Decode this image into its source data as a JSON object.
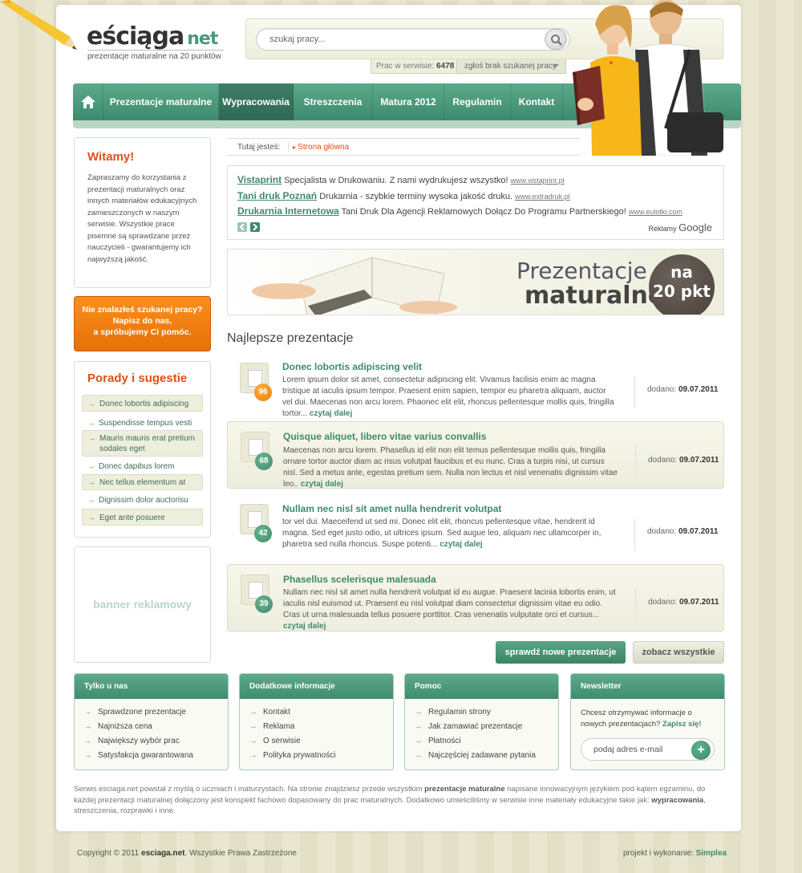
{
  "logo": {
    "main": "eściąga",
    "net": "net",
    "tagline": "prezentacje maturalne na 20 punktów"
  },
  "search": {
    "placeholder": "szukaj pracy...",
    "stats_label": "Prac w serwisie:",
    "stats_count": "6478",
    "report_label": "zgłoś brak szukanej pracy"
  },
  "nav": {
    "items": [
      "Prezentacje maturalne",
      "Wypracowania",
      "Streszczenia",
      "Matura 2012",
      "Regulamin",
      "Kontakt"
    ],
    "active": "Wypracowania"
  },
  "breadcrumb": {
    "label": "Tutaj jesteś:",
    "current": "Strona główna"
  },
  "ads": {
    "items": [
      {
        "title": "Vistaprint",
        "text": "Specjalista w Drukowaniu. Z nami wydrukujesz wszystko!",
        "url": "www.vistaprint.pl"
      },
      {
        "title": "Tani druk Poznań",
        "text": "Drukarnia - szybkie terminy wysoka jakość druku.",
        "url": "www.extradruk.pl"
      },
      {
        "title": "Drukarnia Internetowa",
        "text": "Tani Druk Dla Agencji Reklamowych Dołącz Do Programu Partnerskiego!",
        "url": "www.eulotki.com"
      }
    ],
    "by": "Reklamy",
    "brand": "Google"
  },
  "banner": {
    "line1": "Prezentacje",
    "line2": "maturalne",
    "circle1": "na",
    "circle2": "20 pkt"
  },
  "section_title": "Najlepsze prezentacje",
  "presentations": [
    {
      "score": "96",
      "title": "Donec lobortis adipiscing velit",
      "desc": "Lorem ipsum dolor sit amet, consectetur adipiscing elit. Vivamus facilisis enim ac magna tristique at iaculis ipsum tempor. Praesent enim sapien, tempor eu pharetra aliquam, auctor vel dui. Maecenas non arcu lorem. Phaonec elit elit, rhoncus pellentesque mollis quis, fringilla tortor...",
      "more": "czytaj dalej",
      "date_label": "dodano:",
      "date": "09.07.2011"
    },
    {
      "score": "68",
      "title": "Quisque aliquet, libero vitae varius convallis",
      "desc": "Maecenas non arcu lorem. Phasellus id elit non elit temus pellentesque mollis quis, fringilla ornare tortor auctor diam ac risus volutpat faucibus et eu nunc. Cras a turpis nisi, ut cursus nisl. Sed a metus ante, egestas pretium sem. Nulla non lectus et nisl venenatis dignissim vitae leo..",
      "more": "czytaj dalej",
      "date_label": "dodano:",
      "date": "09.07.2011"
    },
    {
      "score": "42",
      "title": "Nullam nec nisl sit amet nulla hendrerit volutpat",
      "desc": "tor vel dui. Maeceifend ut sed mi. Donec elit elit, rhoncus pellentesque  vitae, hendrerit id magna. Sed eget justo odio, ut ultrices ipsum. Sed augue leo, aliquam nec ullamcorper in, pharetra sed nulla rhoncus. Suspe potenti...",
      "more": "czytaj dalej",
      "date_label": "dodano:",
      "date": "09.07.2011"
    },
    {
      "score": "39",
      "title": "Phasellus scelerisque malesuada",
      "desc": "Nullam nec nisl sit amet nulla hendrerit volutpat id eu augue. Praesent lacinia lobortis enim, ut iaculis nisl euismod ut. Praesent eu nisl volutpat diam consectetur dignissim vitae eu odio. Cras ut urna malesuada tellus posuere porttitor. Cras venenatis vulputate orci et cursus...",
      "more": "czytaj dalej",
      "date_label": "dodano:",
      "date": "09.07.2011"
    }
  ],
  "buttons": {
    "new": "sprawdź nowe prezentacje",
    "all": "zobacz wszystkie"
  },
  "sidebar": {
    "welcome_title": "Witamy!",
    "welcome_text": "Zapraszamy do korzystania z prezentacji maturalnych oraz innych materiałów edukacyjnych zamieszczonych w naszym serwisie. Wszystkie prace pisemne są sprawdzane przez nauczycieli - gwarantujemy ich najwyższą jakość.",
    "cta": [
      "Nie znalazłeś szukanej pracy?",
      "Napisz do nas,",
      "a spróbujemy Ci pomóc."
    ],
    "tips_title": "Porady i sugestie",
    "tips": [
      "Donec lobortis adipiscing",
      "Suspendisse tempus vesti",
      "Mauris mauris erat pretium sodales eget",
      "Donec dapibus lorem",
      "Nec tellus elementum at",
      "Dignissim dolor auctorisu",
      "Eget ante posuere"
    ],
    "ad_banner": "banner reklamowy"
  },
  "footer_boxes": [
    {
      "title": "Tylko u nas",
      "links": [
        "Sprawdzone prezentacje",
        "Najniższa cena",
        "Największy wybór prac",
        "Satysfakcja gwarantowana"
      ]
    },
    {
      "title": "Dodatkowe informacje",
      "links": [
        "Kontakt",
        "Reklama",
        "O serwisie",
        "Polityka prywatności"
      ]
    },
    {
      "title": "Pomoc",
      "links": [
        "Regulamin strony",
        "Jak zamawiać prezentacje",
        "Płatności",
        "Najczęściej zadawane pytania"
      ]
    }
  ],
  "newsletter": {
    "title": "Newsletter",
    "text": "Chcesz otrzymywać informacje o nowych prezentacjach?",
    "cta": "Zapisz się!",
    "placeholder": "podaj adres e-mail",
    "button": "+"
  },
  "about": {
    "p1": "Serwis esciaga.net powstał z myślą o uczniach i maturzystach. Na stronie znajdziesz przede wszystkim",
    "b1": "prezentacje maturalne",
    "p2": "napisane innowacyjnym językiem pod kątem egzaminu, do każdej prezentacji maturalnej dołączony jest konspekt fachowo dopasowany do prac maturalnych. Dodatkowo umieściliśmy w serwisie inne materiały edukacyjne takie jak:",
    "b2": "wypracowania",
    "p3": ", streszczenia, rozprawki i inne."
  },
  "footer": {
    "copy_prefix": "Copyright © 2011",
    "copy_site": "esciaga.net",
    "copy_suffix": ". Wszystkie Prawa Zastrzeżone",
    "credit_label": "projekt i wykonanie:",
    "credit_name": "Simplea"
  },
  "colors": {
    "accent": "#3f8a6d",
    "orange": "#e0501a",
    "cta": "#f58a16"
  },
  "icons": [
    "pencil-icon",
    "search-icon",
    "home-icon",
    "document-icon",
    "arrow-right-icon",
    "plus-icon"
  ]
}
